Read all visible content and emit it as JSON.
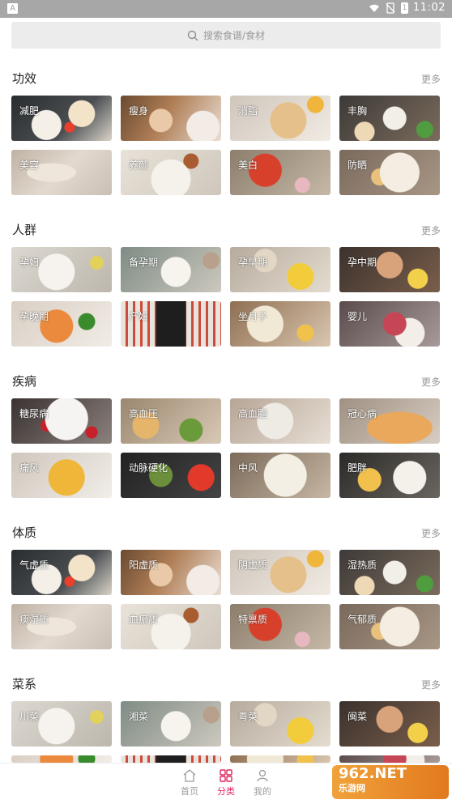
{
  "status": {
    "time": "11:02",
    "battery": "1"
  },
  "search": {
    "placeholder": "搜索食谱/食材"
  },
  "more_label": "更多",
  "sections": [
    {
      "title": "功效",
      "items": [
        "减肥",
        "瘦身",
        "消脂",
        "丰胸",
        "美容",
        "养颜",
        "美白",
        "防晒"
      ]
    },
    {
      "title": "人群",
      "items": [
        "孕妇",
        "备孕期",
        "孕早期",
        "孕中期",
        "孕晚期",
        "产妇",
        "坐月子",
        "婴儿"
      ]
    },
    {
      "title": "疾病",
      "items": [
        "糖尿病",
        "高血压",
        "高血脂",
        "冠心病",
        "痛风",
        "动脉硬化",
        "中风",
        "肥胖"
      ]
    },
    {
      "title": "体质",
      "items": [
        "气虚质",
        "阳虚质",
        "阴虚质",
        "湿热质",
        "痰湿质",
        "血瘀质",
        "特禀质",
        "气郁质"
      ]
    },
    {
      "title": "菜系",
      "items": [
        "川菜",
        "湘菜",
        "粤菜",
        "闽菜"
      ]
    }
  ],
  "tabbar": {
    "home": "首页",
    "category": "分类",
    "mine": "我的"
  },
  "colors": {
    "accent": "#e0245e",
    "muted": "#9a9a9a"
  },
  "watermark": {
    "line1": "962.NET",
    "line2": "乐游网"
  }
}
